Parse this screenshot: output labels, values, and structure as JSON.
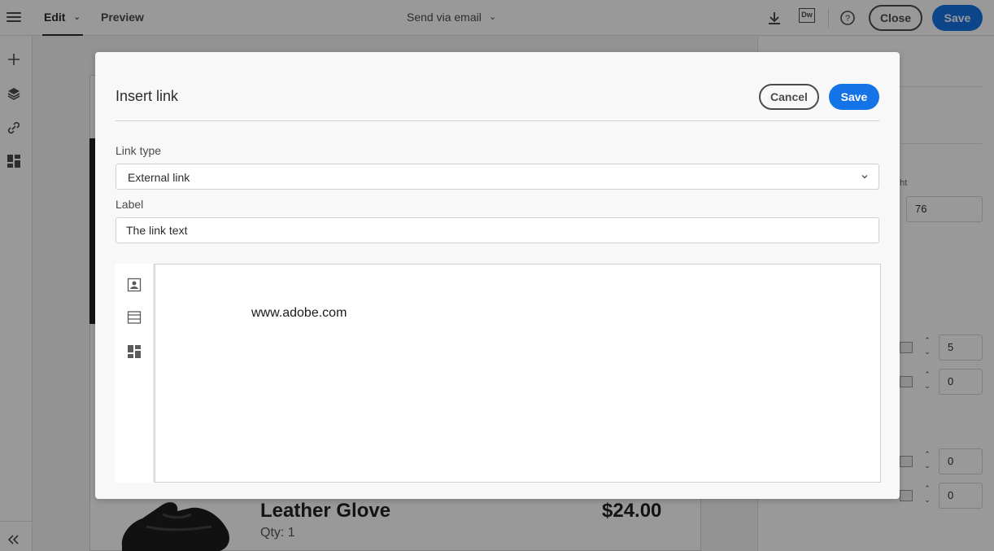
{
  "topbar": {
    "edit_tab": "Edit",
    "preview_tab": "Preview",
    "send_via": "Send via email",
    "dw_badge": "Dw",
    "close_label": "Close",
    "save_label": "Save"
  },
  "background": {
    "product_name": "Leather Glove",
    "product_price": "$24.00",
    "product_qty": "Qty: 1"
  },
  "right_panel": {
    "label_partial": "ght",
    "height_value": "76",
    "field_1": "5",
    "field_2": "0",
    "field_3": "0",
    "field_4": "0"
  },
  "dialog": {
    "title": "Insert link",
    "cancel_label": "Cancel",
    "save_label": "Save",
    "link_type_label": "Link type",
    "link_type_value": "External link",
    "label_label": "Label",
    "label_value": "The link text",
    "editor_text": "www.adobe.com"
  },
  "colors": {
    "accent": "#1473e6",
    "overlay": "rgba(0,0,0,0.4)"
  },
  "icons": [
    "menu-icon",
    "chevron-down-icon",
    "download-icon",
    "dreamweaver-icon",
    "help-icon",
    "add-icon",
    "layers-icon",
    "link-icon",
    "components-icon",
    "collapse-icon",
    "image-block-icon",
    "structure-icon",
    "fragment-icon"
  ]
}
